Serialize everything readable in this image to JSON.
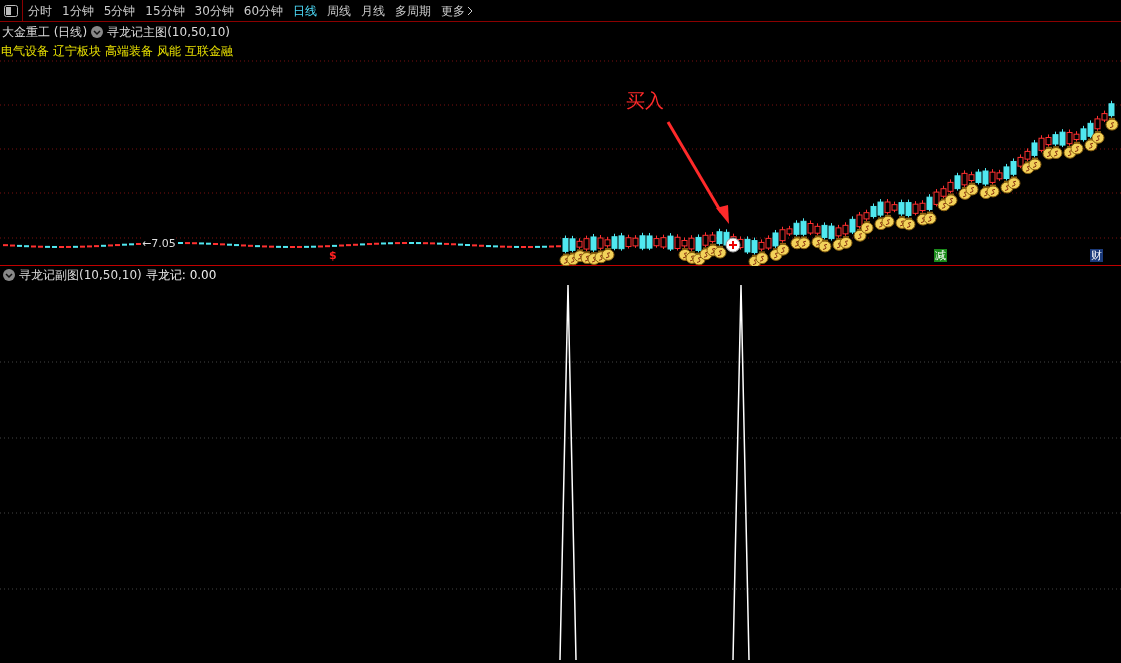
{
  "toolbar": {
    "tabs": [
      {
        "label": "分时",
        "selected": false
      },
      {
        "label": "1分钟",
        "selected": false
      },
      {
        "label": "5分钟",
        "selected": false
      },
      {
        "label": "15分钟",
        "selected": false
      },
      {
        "label": "30分钟",
        "selected": false
      },
      {
        "label": "60分钟",
        "selected": false
      },
      {
        "label": "日线",
        "selected": true
      },
      {
        "label": "周线",
        "selected": false
      },
      {
        "label": "月线",
        "selected": false
      },
      {
        "label": "多周期",
        "selected": false
      }
    ],
    "more": "更多"
  },
  "stock": {
    "name": "大金重工 (日线)",
    "indicator": "寻龙记主图(10,50,10)"
  },
  "sectors": [
    "电气设备",
    "辽宁板块",
    "高端装备",
    "风能",
    "互联金融"
  ],
  "main_chart": {
    "price_label": "←7.05",
    "buy_label": "买入",
    "markers": [
      {
        "kind": "dollar",
        "text": "$"
      },
      {
        "kind": "reduce",
        "text": "减"
      },
      {
        "kind": "wealth",
        "text": "财"
      }
    ]
  },
  "sub_chart": {
    "indicator": "寻龙记副图(10,50,10)",
    "reading": "寻龙记: 0.00"
  }
}
